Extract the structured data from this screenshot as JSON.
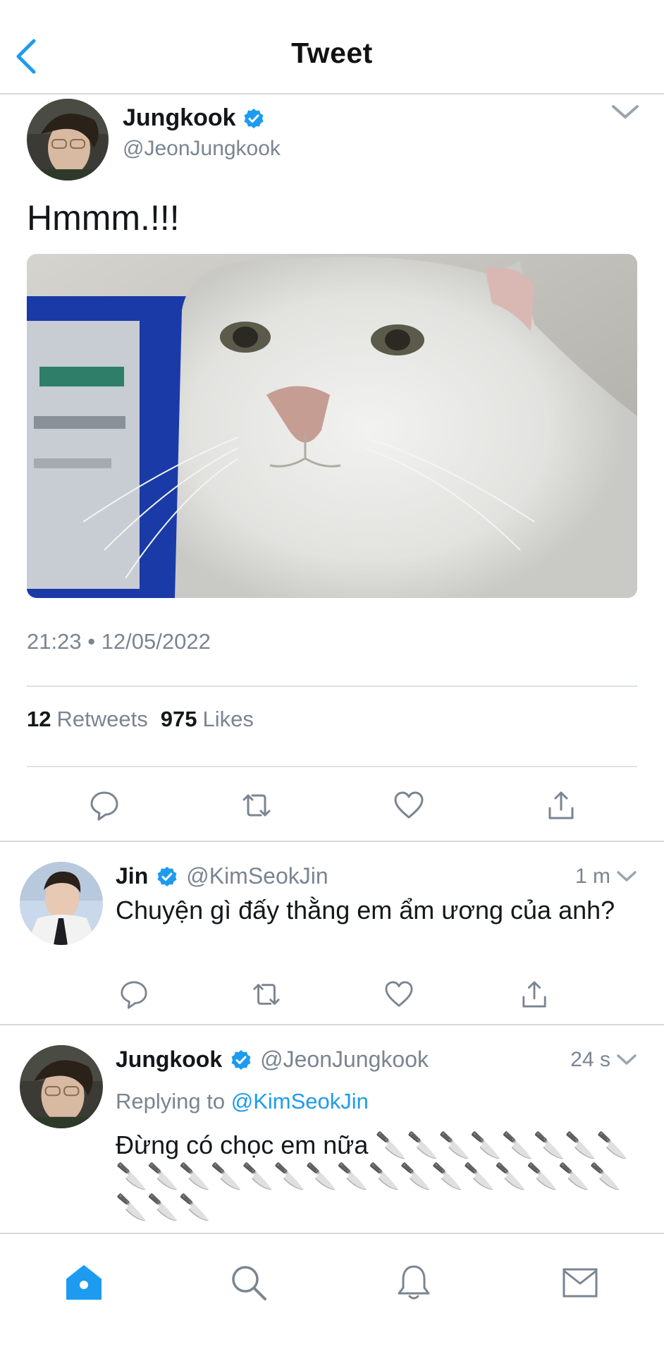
{
  "header": {
    "title": "Tweet"
  },
  "main_tweet": {
    "author_name": "Jungkook",
    "author_handle": "@JeonJungkook",
    "text": "Hmmm.!!!",
    "time": "21:23",
    "separator": "•",
    "date": "12/05/2022",
    "retweets_count": "12",
    "retweets_label": "Retweets",
    "likes_count": "975",
    "likes_label": "Likes"
  },
  "replies": [
    {
      "author_name": "Jin",
      "author_handle": "@KimSeokJin",
      "time": "1 m",
      "text": "Chuyện gì đấy thằng em ẩm ương của anh?"
    },
    {
      "author_name": "Jungkook",
      "author_handle": "@JeonJungkook",
      "time": "24 s",
      "replying_label": "Replying to",
      "replying_to": "@KimSeokJin",
      "text": "Đừng có chọc em nữa 🔪🔪🔪🔪🔪🔪🔪🔪🔪🔪🔪🔪🔪🔪🔪🔪🔪🔪🔪🔪🔪🔪🔪🔪🔪🔪🔪"
    }
  ],
  "colors": {
    "accent": "#1d9bf0",
    "verified": "#1d9bf0",
    "muted": "#7a8590",
    "divider": "#d3d8dd"
  },
  "icons": [
    "back-arrow-icon",
    "chevron-down-icon",
    "verified-badge-icon",
    "reply-icon",
    "retweet-icon",
    "like-icon",
    "share-icon",
    "home-icon",
    "search-icon",
    "notifications-icon",
    "messages-icon"
  ]
}
